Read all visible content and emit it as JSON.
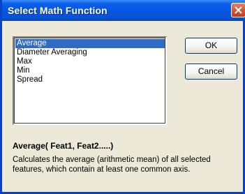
{
  "window": {
    "title": "Select Math Function"
  },
  "functions": [
    {
      "label": "Average",
      "selected": true
    },
    {
      "label": "Diameter Averaging",
      "selected": false
    },
    {
      "label": "Max",
      "selected": false
    },
    {
      "label": "Min",
      "selected": false
    },
    {
      "label": "Spread",
      "selected": false
    }
  ],
  "buttons": {
    "ok_label": "OK",
    "cancel_label": "Cancel"
  },
  "details": {
    "signature": "Average( Feat1, Feat2.....)",
    "description_line1": "Calculates the average (arithmetic mean) of all selected",
    "description_line2": "features, which contain at least one common axis."
  },
  "colors": {
    "title_bar": "#0655e0",
    "selection": "#316ac5",
    "close_button": "#d75a3e"
  },
  "icons": {
    "close": "close-icon"
  }
}
